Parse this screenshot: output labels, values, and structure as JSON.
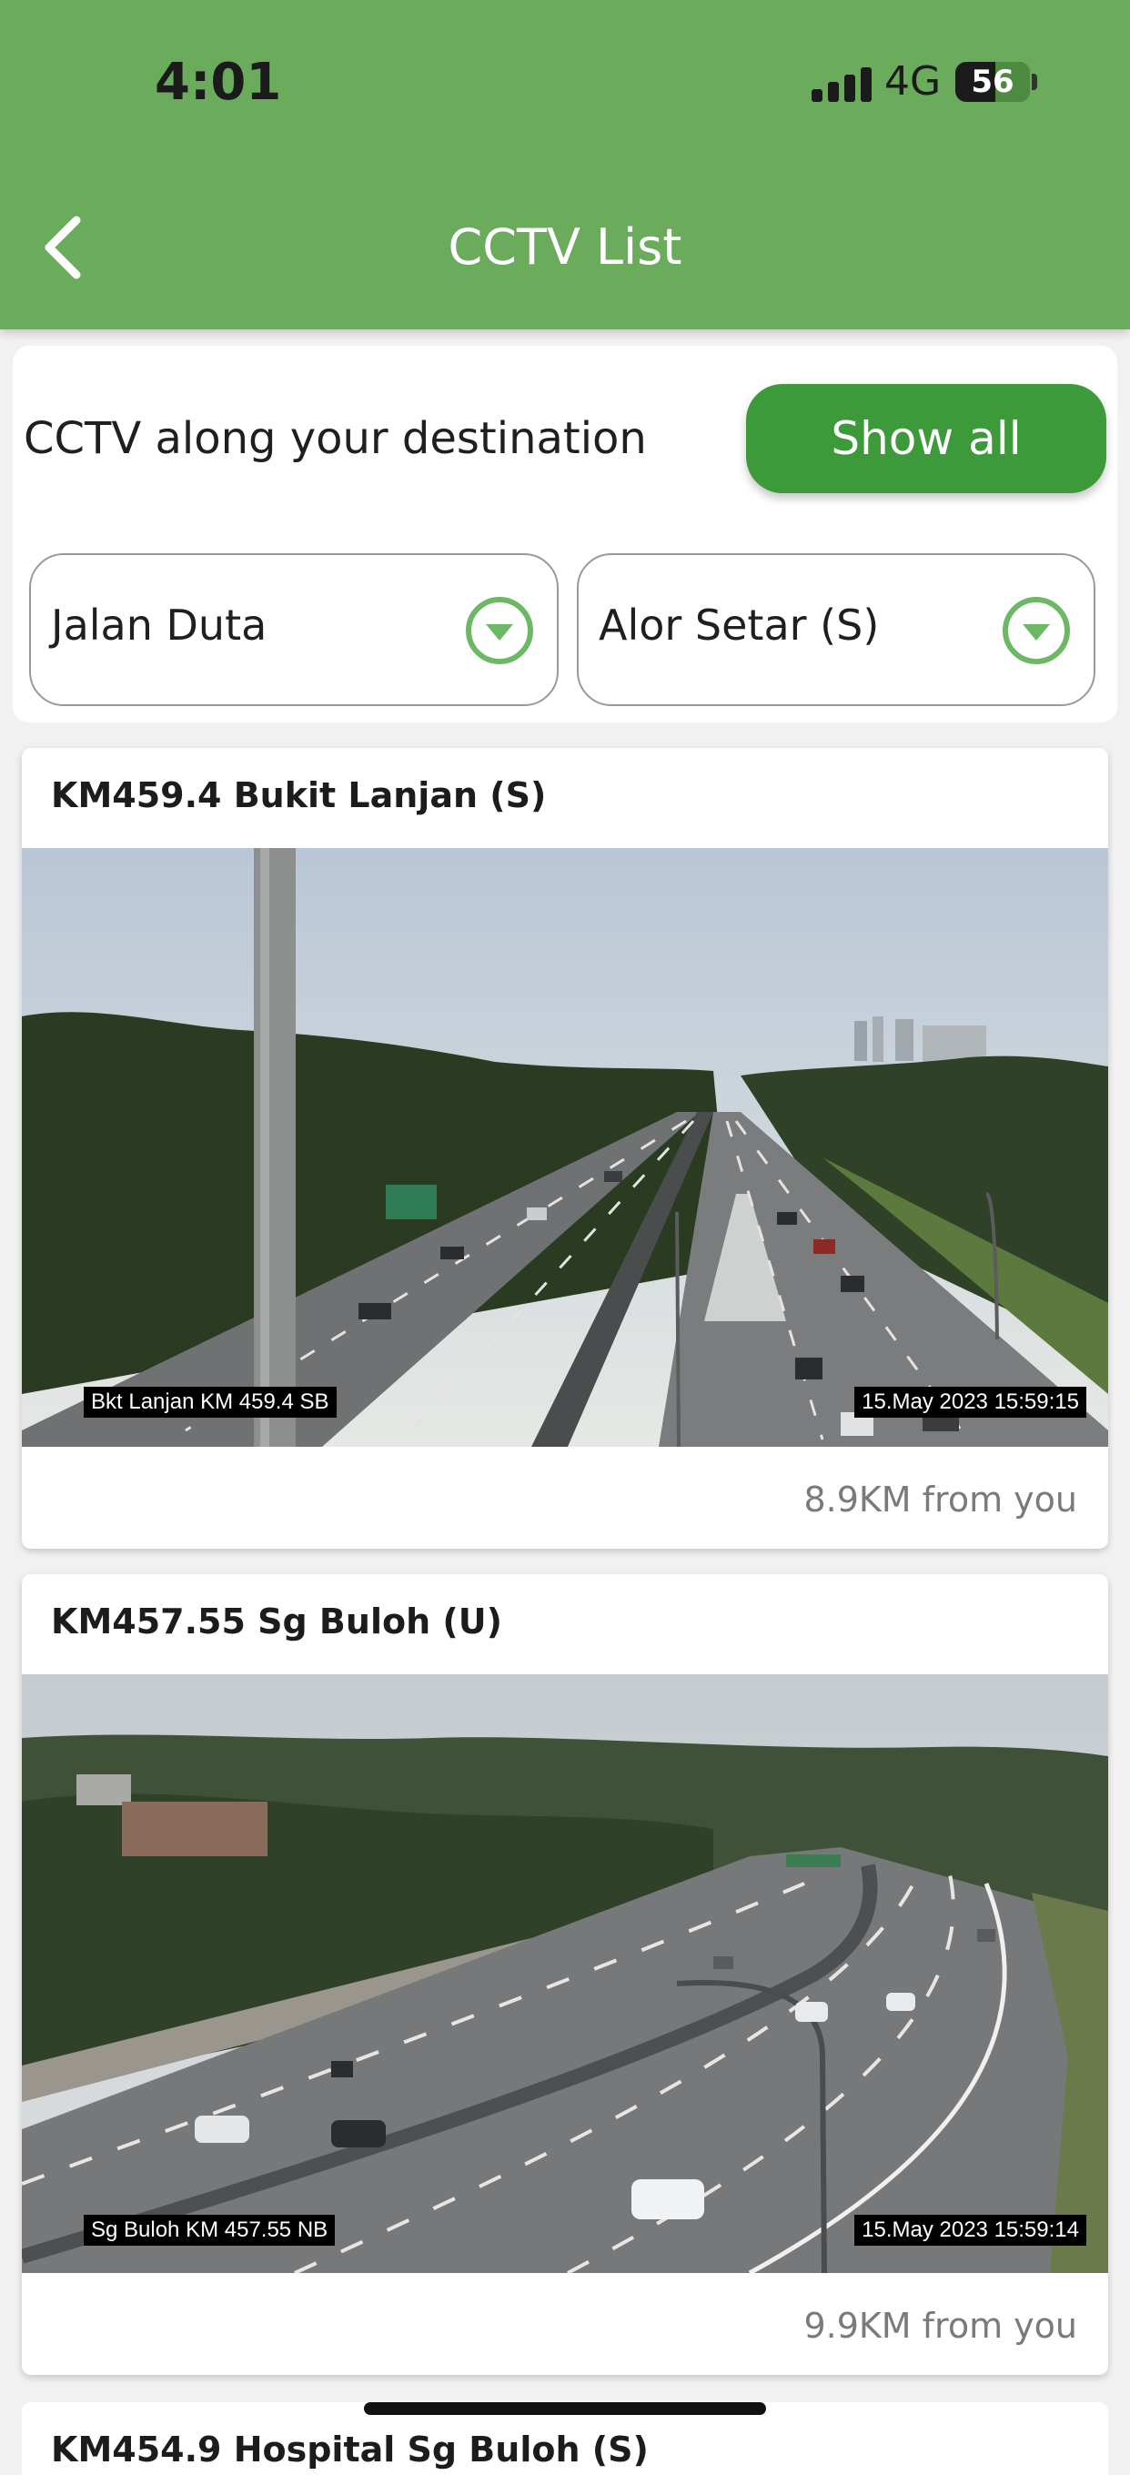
{
  "status_bar": {
    "time": "4:01",
    "network": "4G",
    "battery": "56"
  },
  "header": {
    "title": "CCTV List",
    "back_icon": "chevron-left-icon"
  },
  "filter": {
    "label": "CCTV along your destination",
    "show_all_label": "Show all",
    "origin": "Jalan Duta",
    "destination": "Alor Setar (S)"
  },
  "colors": {
    "header": "#6aac5b",
    "button": "#3c9a3b",
    "accent": "#6cb865"
  },
  "cctv": [
    {
      "title": "KM459.4 Bukit Lanjan (S)",
      "camera_label": "Bkt Lanjan KM 459.4 SB",
      "timestamp": "15.May 2023   15:59:15",
      "distance": "8.9KM from you"
    },
    {
      "title": "KM457.55 Sg Buloh (U)",
      "camera_label": "Sg Buloh KM 457.55 NB",
      "timestamp": "15.May 2023   15:59:14",
      "distance": "9.9KM from you"
    },
    {
      "title": "KM454.9 Hospital Sg Buloh (S)"
    }
  ]
}
